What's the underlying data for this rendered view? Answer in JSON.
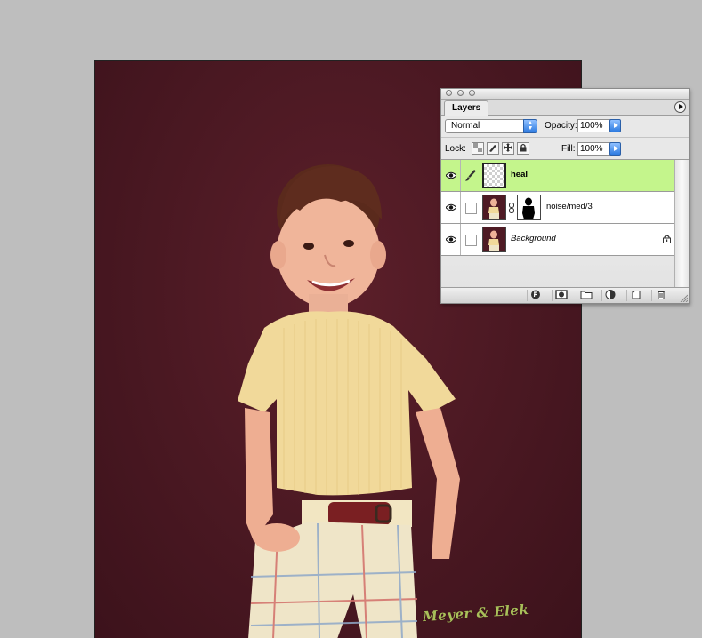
{
  "palette": {
    "tab_label": "Layers",
    "blend_mode": "Normal",
    "opacity_label": "Opacity:",
    "opacity_value": "100%",
    "lock_label": "Lock:",
    "fill_label": "Fill:",
    "fill_value": "100%",
    "layers": [
      {
        "name": "heal",
        "selected": true,
        "visible": true,
        "has_brush": true
      },
      {
        "name": "noise/med/3",
        "selected": false,
        "visible": true,
        "has_mask": true
      },
      {
        "name": "Background",
        "selected": false,
        "visible": true,
        "locked": true
      }
    ]
  },
  "canvas": {
    "signature": "Meyer & Elek"
  },
  "colors": {
    "selected_layer": "#c4f58c",
    "canvas_background": "#4a1822",
    "app_background": "#bebebe",
    "accent_blue": "#2d7be0"
  },
  "icons": {
    "visibility": "eye-icon",
    "paint": "paintbrush-icon",
    "lock": "padlock-icon",
    "mask_link": "chain-icon",
    "palette_menu": "flyout-menu-icon"
  }
}
